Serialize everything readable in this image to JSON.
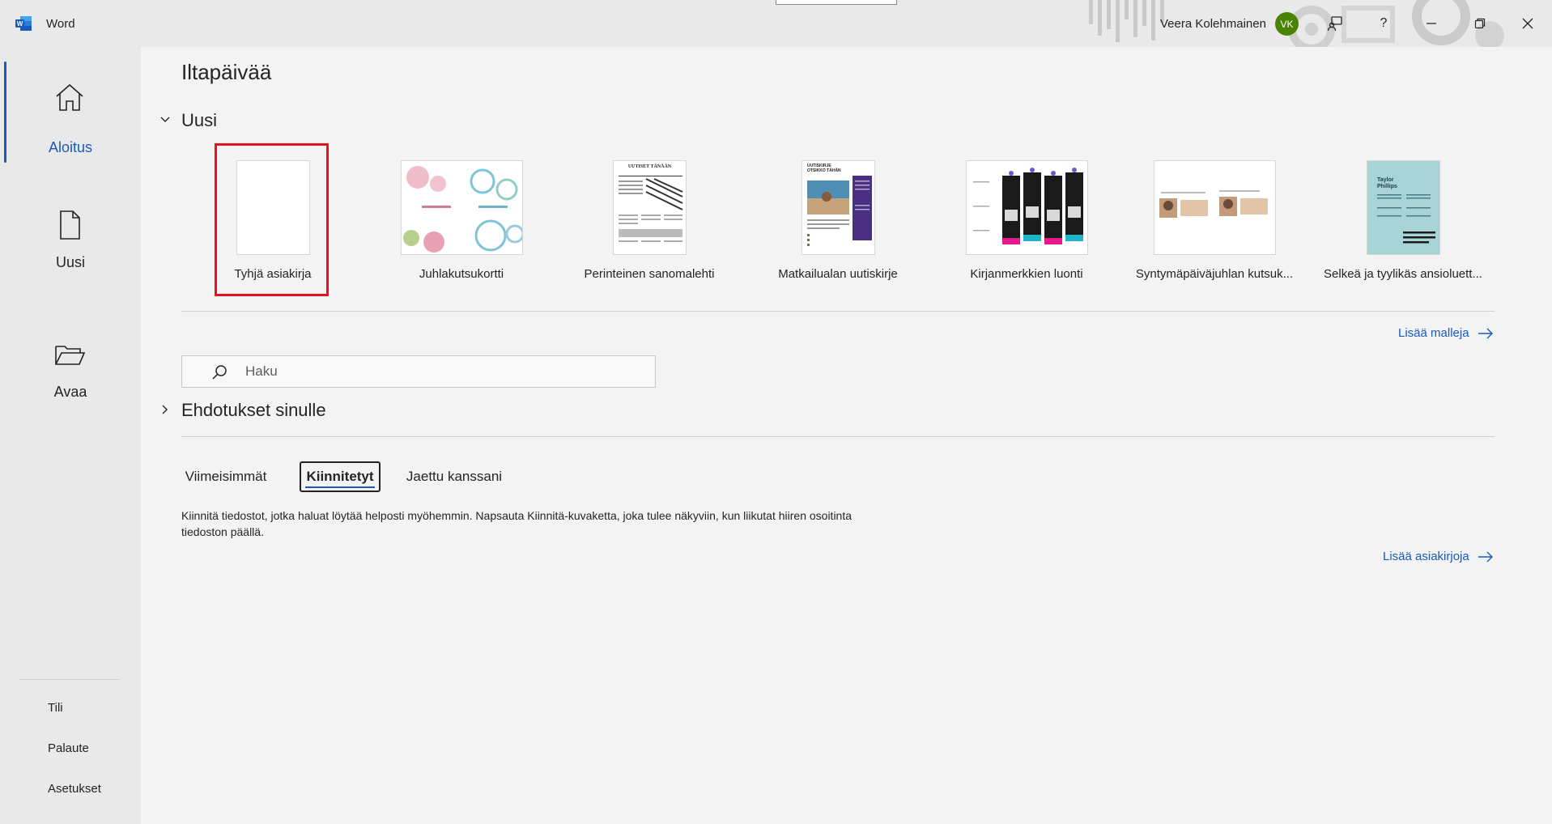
{
  "app": {
    "title": "Word",
    "user_name": "Veera Kolehmainen",
    "user_initials": "VK",
    "accent_color": "#185abd",
    "avatar_color": "#498205"
  },
  "nav": {
    "home_label": "Aloitus",
    "new_label": "Uusi",
    "open_label": "Avaa",
    "account_label": "Tili",
    "feedback_label": "Palaute",
    "options_label": "Asetukset"
  },
  "main": {
    "greeting": "Iltapäivää",
    "new_section_title": "Uusi",
    "templates": [
      {
        "label": "Tyhjä asiakirja",
        "icon": "blank-document"
      },
      {
        "label": "Juhlakutsukortti",
        "icon": "party-card"
      },
      {
        "label": "Perinteinen sanomalehti",
        "icon": "newspaper"
      },
      {
        "label": "Matkailualan uutiskirje",
        "icon": "newsletter"
      },
      {
        "label": "Kirjanmerkkien luonti",
        "icon": "bookmarks"
      },
      {
        "label": "Syntymäpäiväjuhlan kutsuk...",
        "icon": "birthday-invitation"
      },
      {
        "label": "Selkeä ja tyylikäs ansioluett...",
        "icon": "resume"
      }
    ],
    "more_templates_label": "Lisää malleja",
    "search_placeholder": "Haku",
    "suggestions_title": "Ehdotukset sinulle",
    "tabs": [
      {
        "label": "Viimeisimmät",
        "selected": false
      },
      {
        "label": "Kiinnitetyt",
        "selected": true
      },
      {
        "label": "Jaettu kanssani",
        "selected": false
      }
    ],
    "pinned_info": "Kiinnitä tiedostot, jotka haluat löytää helposti myöhemmin. Napsauta Kiinnitä-kuvaketta, joka tulee näkyviin, kun liikutat hiiren osoitinta tiedoston päällä.",
    "more_documents_label": "Lisää asiakirjoja",
    "thumbnail_texts": {
      "newspaper_title": "UUTISET TÄNÄÄN",
      "newsletter_title": "UUTISKIRJE OTSIKKO TÄHÄN",
      "resume_name": "Taylor Phillips"
    }
  }
}
